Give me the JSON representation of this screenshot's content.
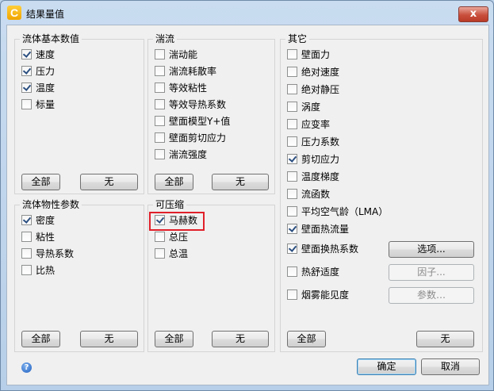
{
  "window": {
    "title": "结果量值",
    "app_icon": "C",
    "close_glyph": "x"
  },
  "groups": {
    "basic": {
      "title": "流体基本数值",
      "items": [
        {
          "label": "速度",
          "checked": true
        },
        {
          "label": "压力",
          "checked": true
        },
        {
          "label": "温度",
          "checked": true
        },
        {
          "label": "标量",
          "checked": false
        }
      ],
      "all_label": "全部",
      "none_label": "无"
    },
    "turbulence": {
      "title": "湍流",
      "items": [
        {
          "label": "湍动能",
          "checked": false
        },
        {
          "label": "湍流耗散率",
          "checked": false
        },
        {
          "label": "等效粘性",
          "checked": false
        },
        {
          "label": "等效导热系数",
          "checked": false
        },
        {
          "label": "壁面模型Y+值",
          "checked": false
        },
        {
          "label": "壁面剪切应力",
          "checked": false
        },
        {
          "label": "湍流强度",
          "checked": false
        }
      ],
      "all_label": "全部",
      "none_label": "无"
    },
    "properties": {
      "title": "流体物性参数",
      "items": [
        {
          "label": "密度",
          "checked": true
        },
        {
          "label": "粘性",
          "checked": false
        },
        {
          "label": "导热系数",
          "checked": false
        },
        {
          "label": "比热",
          "checked": false
        }
      ],
      "all_label": "全部",
      "none_label": "无"
    },
    "compressible": {
      "title": "可压缩",
      "items": [
        {
          "label": "马赫数",
          "checked": true
        },
        {
          "label": "总压",
          "checked": false
        },
        {
          "label": "总温",
          "checked": false
        }
      ],
      "all_label": "全部",
      "none_label": "无"
    },
    "other": {
      "title": "其它",
      "items": [
        {
          "label": "壁面力",
          "checked": false
        },
        {
          "label": "绝对速度",
          "checked": false
        },
        {
          "label": "绝对静压",
          "checked": false
        },
        {
          "label": "涡度",
          "checked": false
        },
        {
          "label": "应变率",
          "checked": false
        },
        {
          "label": "压力系数",
          "checked": false
        },
        {
          "label": "剪切应力",
          "checked": true
        },
        {
          "label": "温度梯度",
          "checked": false
        },
        {
          "label": "流函数",
          "checked": false
        },
        {
          "label": "平均空气龄（LMA）",
          "checked": false
        },
        {
          "label": "壁面热流量",
          "checked": true
        },
        {
          "label": "壁面换热系数",
          "checked": true
        },
        {
          "label": "热舒适度",
          "checked": false
        },
        {
          "label": "烟雾能见度",
          "checked": false
        }
      ],
      "options_label": "选项...",
      "factor_label": "因子...",
      "params_label": "参数…",
      "all_label": "全部",
      "none_label": "无"
    }
  },
  "footer": {
    "ok_label": "确定",
    "cancel_label": "取消",
    "help_glyph": "?"
  },
  "colors": {
    "highlight": "#e0202a",
    "accent": "#3c7fb1"
  }
}
